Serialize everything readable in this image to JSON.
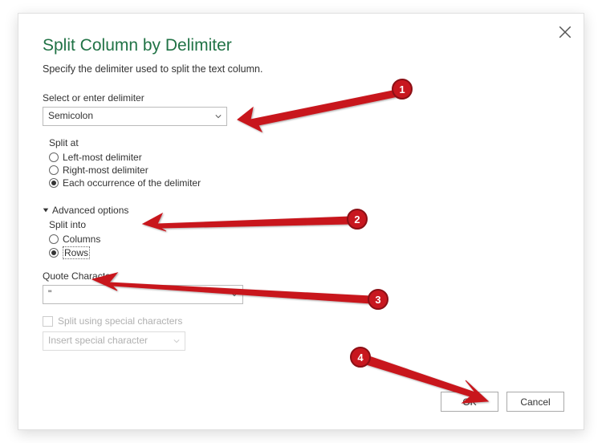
{
  "title": "Split Column by Delimiter",
  "subtitle": "Specify the delimiter used to split the text column.",
  "delimiter": {
    "label": "Select or enter delimiter",
    "value": "Semicolon"
  },
  "splitAt": {
    "label": "Split at",
    "options": [
      "Left-most delimiter",
      "Right-most delimiter",
      "Each occurrence of the delimiter"
    ],
    "selected": "Each occurrence of the delimiter"
  },
  "advanced": {
    "label": "Advanced options",
    "expanded": true
  },
  "splitInto": {
    "label": "Split into",
    "options": [
      "Columns",
      "Rows"
    ],
    "selected": "Rows"
  },
  "quote": {
    "label": "Quote Character",
    "value": "\""
  },
  "special": {
    "checkLabel": "Split using special characters",
    "checked": false,
    "dropdown": "Insert special character"
  },
  "buttons": {
    "ok": "OK",
    "cancel": "Cancel"
  },
  "callouts": [
    "1",
    "2",
    "3",
    "4"
  ]
}
